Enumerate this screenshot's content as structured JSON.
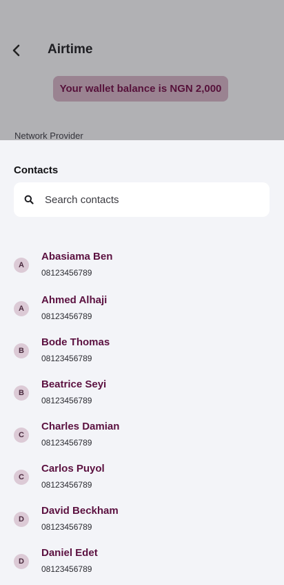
{
  "header": {
    "title": "Airtime",
    "back_icon": "chevron-left-icon"
  },
  "wallet": {
    "text": "Your wallet balance is NGN 2,000"
  },
  "form": {
    "network_label": "Network Provider"
  },
  "sheet": {
    "title": "Contacts",
    "search": {
      "placeholder": "Search contacts",
      "value": "",
      "icon": "search-icon"
    },
    "contacts": [
      {
        "initial": "A",
        "name": "Abasiama Ben",
        "phone": "08123456789"
      },
      {
        "initial": "A",
        "name": "Ahmed Alhaji",
        "phone": "08123456789"
      },
      {
        "initial": "B",
        "name": "Bode Thomas",
        "phone": "08123456789"
      },
      {
        "initial": "B",
        "name": "Beatrice Seyi",
        "phone": "08123456789"
      },
      {
        "initial": "C",
        "name": "Charles Damian",
        "phone": "08123456789"
      },
      {
        "initial": "C",
        "name": "Carlos Puyol",
        "phone": "08123456789"
      },
      {
        "initial": "D",
        "name": "David Beckham",
        "phone": "08123456789"
      },
      {
        "initial": "D",
        "name": "Daniel Edet",
        "phone": "08123456789"
      }
    ]
  },
  "colors": {
    "overlay": "#b1b1b4",
    "sheet_bg": "#f3f4f8",
    "brand": "#5b1140",
    "avatar_bg": "#dccad6",
    "wallet_pill": "#9a8391"
  }
}
